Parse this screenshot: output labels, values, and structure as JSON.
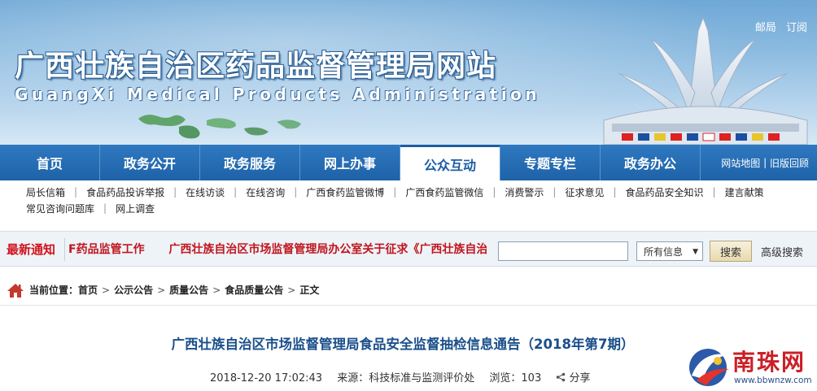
{
  "header": {
    "title": "广西壮族自治区药品监督管理局网站",
    "subtitle": "GuangXi Medical Products Administration",
    "top_links": [
      "邮局",
      "订阅"
    ]
  },
  "main_nav": {
    "items": [
      "首页",
      "政务公开",
      "政务服务",
      "网上办事",
      "公众互动",
      "专题专栏",
      "政务办公"
    ],
    "active_index": 4,
    "extra": [
      "网站地图",
      "旧版回顾"
    ]
  },
  "sub_nav": {
    "row1": [
      "局长信箱",
      "食品药品投诉举报",
      "在线访谈",
      "在线咨询",
      "广西食药监管微博",
      "广西食药监管微信",
      "消费警示",
      "征求意见",
      "食品药品安全知识",
      "建言献策"
    ],
    "row2": [
      "常见咨询问题库",
      "网上调查"
    ]
  },
  "notice": {
    "label": "最新通知",
    "items": [
      "F药品监管工作",
      "广西壮族自治区市场监督管理局办公室关于征求《广西壮族自治"
    ]
  },
  "search": {
    "input_value": "",
    "select_value": "所有信息",
    "button_label": "搜索",
    "advanced_label": "高级搜索"
  },
  "breadcrumb": {
    "label": "当前位置：",
    "items": [
      "首页",
      "公示公告",
      "质量公告",
      "食品质量公告",
      "正文"
    ],
    "separator": ">"
  },
  "article": {
    "title": "广西壮族自治区市场监督管理局食品安全监督抽检信息通告（2018年第7期）",
    "datetime": "2018-12-20 17:02:43",
    "source_label": "来源：",
    "source": "科技标准与监测评价处",
    "views_label": "浏览：",
    "views": "103",
    "share_label": "分享"
  },
  "watermark": {
    "text": "南珠网",
    "url": "www.bbwnzw.com"
  },
  "colors": {
    "nav_blue": "#1e62a8",
    "notice_red": "#d0121b",
    "title_blue": "#1a4f8a"
  }
}
